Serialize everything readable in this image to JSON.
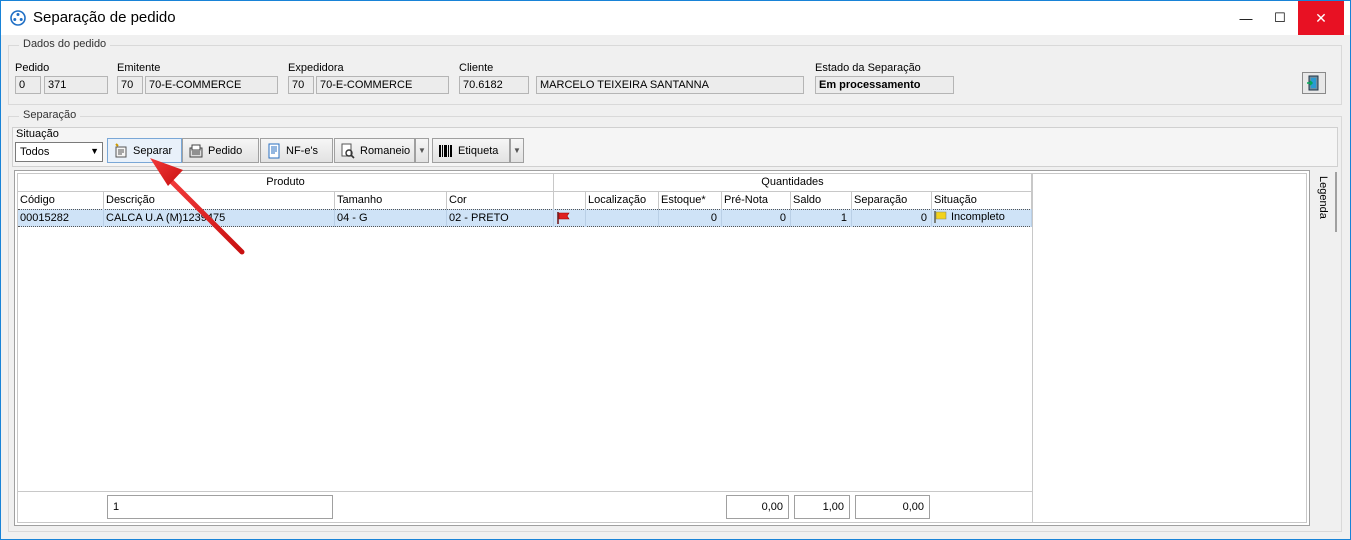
{
  "window": {
    "title": "Separação de pedido",
    "minimize": "—",
    "maximize": "☐",
    "close": "✕"
  },
  "dados": {
    "group_title": "Dados do pedido",
    "pedido_label": "Pedido",
    "pedido_a": "0",
    "pedido_b": "371",
    "emitente_label": "Emitente",
    "emitente_code": "70",
    "emitente_name": "70-E-COMMERCE",
    "expedidora_label": "Expedidora",
    "expedidora_code": "70",
    "expedidora_name": "70-E-COMMERCE",
    "cliente_label": "Cliente",
    "cliente_code": "70.6182",
    "cliente_name": "MARCELO TEIXEIRA SANTANNA",
    "estado_label": "Estado da Separação",
    "estado_value": "Em processamento"
  },
  "separacao": {
    "group_title": "Separação",
    "situacao_label": "Situação",
    "situacao_value": "Todos",
    "buttons": {
      "separar": "Separar",
      "pedido": "Pedido",
      "nfes": "NF-e's",
      "romaneio": "Romaneio",
      "etiqueta": "Etiqueta"
    }
  },
  "grid": {
    "band_produto": "Produto",
    "band_quantidades": "Quantidades",
    "columns": {
      "codigo": "Código",
      "descricao": "Descrição",
      "tamanho": "Tamanho",
      "cor": "Cor",
      "localizacao": "Localização",
      "estoque": "Estoque*",
      "pre_nota": "Pré-Nota",
      "saldo": "Saldo",
      "separacao": "Separação",
      "situacao": "Situação"
    },
    "rows": [
      {
        "codigo": "00015282",
        "descricao": "CALCA U.A (M)1239475",
        "tamanho": "04 - G",
        "cor": "02 - PRETO",
        "localizacao": "",
        "estoque": "0",
        "pre_nota": "0",
        "saldo": "1",
        "separacao": "0",
        "situacao": "Incompleto"
      }
    ],
    "footer": {
      "count": "1",
      "pre_nota_total": "0,00",
      "saldo_total": "1,00",
      "separacao_total": "0,00"
    }
  },
  "legend": {
    "label": "Legenda"
  },
  "colors": {
    "selection": "#cfe3f7",
    "arrow": "#e31b1b",
    "close_button": "#e81123"
  }
}
